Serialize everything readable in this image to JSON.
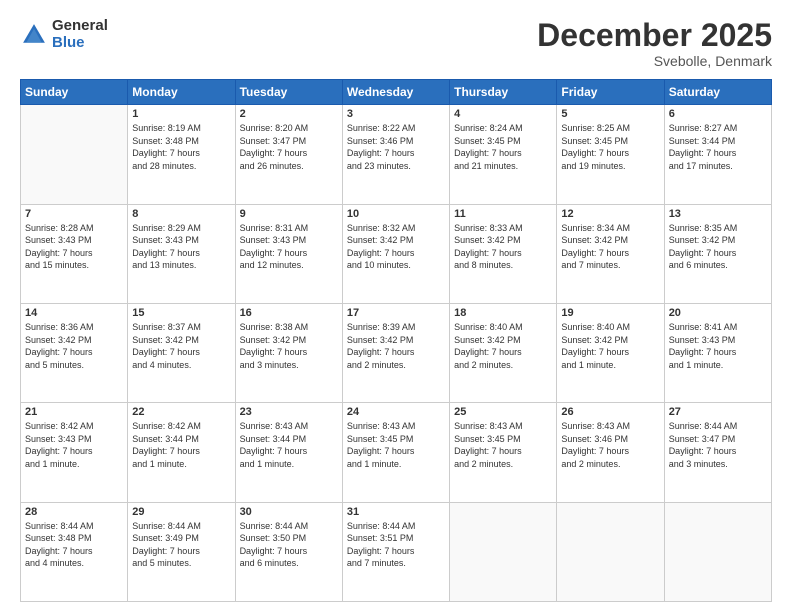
{
  "logo": {
    "general": "General",
    "blue": "Blue"
  },
  "header": {
    "month": "December 2025",
    "location": "Svebolle, Denmark"
  },
  "weekdays": [
    "Sunday",
    "Monday",
    "Tuesday",
    "Wednesday",
    "Thursday",
    "Friday",
    "Saturday"
  ],
  "weeks": [
    [
      {
        "day": "",
        "info": ""
      },
      {
        "day": "1",
        "info": "Sunrise: 8:19 AM\nSunset: 3:48 PM\nDaylight: 7 hours\nand 28 minutes."
      },
      {
        "day": "2",
        "info": "Sunrise: 8:20 AM\nSunset: 3:47 PM\nDaylight: 7 hours\nand 26 minutes."
      },
      {
        "day": "3",
        "info": "Sunrise: 8:22 AM\nSunset: 3:46 PM\nDaylight: 7 hours\nand 23 minutes."
      },
      {
        "day": "4",
        "info": "Sunrise: 8:24 AM\nSunset: 3:45 PM\nDaylight: 7 hours\nand 21 minutes."
      },
      {
        "day": "5",
        "info": "Sunrise: 8:25 AM\nSunset: 3:45 PM\nDaylight: 7 hours\nand 19 minutes."
      },
      {
        "day": "6",
        "info": "Sunrise: 8:27 AM\nSunset: 3:44 PM\nDaylight: 7 hours\nand 17 minutes."
      }
    ],
    [
      {
        "day": "7",
        "info": "Sunrise: 8:28 AM\nSunset: 3:43 PM\nDaylight: 7 hours\nand 15 minutes."
      },
      {
        "day": "8",
        "info": "Sunrise: 8:29 AM\nSunset: 3:43 PM\nDaylight: 7 hours\nand 13 minutes."
      },
      {
        "day": "9",
        "info": "Sunrise: 8:31 AM\nSunset: 3:43 PM\nDaylight: 7 hours\nand 12 minutes."
      },
      {
        "day": "10",
        "info": "Sunrise: 8:32 AM\nSunset: 3:42 PM\nDaylight: 7 hours\nand 10 minutes."
      },
      {
        "day": "11",
        "info": "Sunrise: 8:33 AM\nSunset: 3:42 PM\nDaylight: 7 hours\nand 8 minutes."
      },
      {
        "day": "12",
        "info": "Sunrise: 8:34 AM\nSunset: 3:42 PM\nDaylight: 7 hours\nand 7 minutes."
      },
      {
        "day": "13",
        "info": "Sunrise: 8:35 AM\nSunset: 3:42 PM\nDaylight: 7 hours\nand 6 minutes."
      }
    ],
    [
      {
        "day": "14",
        "info": "Sunrise: 8:36 AM\nSunset: 3:42 PM\nDaylight: 7 hours\nand 5 minutes."
      },
      {
        "day": "15",
        "info": "Sunrise: 8:37 AM\nSunset: 3:42 PM\nDaylight: 7 hours\nand 4 minutes."
      },
      {
        "day": "16",
        "info": "Sunrise: 8:38 AM\nSunset: 3:42 PM\nDaylight: 7 hours\nand 3 minutes."
      },
      {
        "day": "17",
        "info": "Sunrise: 8:39 AM\nSunset: 3:42 PM\nDaylight: 7 hours\nand 2 minutes."
      },
      {
        "day": "18",
        "info": "Sunrise: 8:40 AM\nSunset: 3:42 PM\nDaylight: 7 hours\nand 2 minutes."
      },
      {
        "day": "19",
        "info": "Sunrise: 8:40 AM\nSunset: 3:42 PM\nDaylight: 7 hours\nand 1 minute."
      },
      {
        "day": "20",
        "info": "Sunrise: 8:41 AM\nSunset: 3:43 PM\nDaylight: 7 hours\nand 1 minute."
      }
    ],
    [
      {
        "day": "21",
        "info": "Sunrise: 8:42 AM\nSunset: 3:43 PM\nDaylight: 7 hours\nand 1 minute."
      },
      {
        "day": "22",
        "info": "Sunrise: 8:42 AM\nSunset: 3:44 PM\nDaylight: 7 hours\nand 1 minute."
      },
      {
        "day": "23",
        "info": "Sunrise: 8:43 AM\nSunset: 3:44 PM\nDaylight: 7 hours\nand 1 minute."
      },
      {
        "day": "24",
        "info": "Sunrise: 8:43 AM\nSunset: 3:45 PM\nDaylight: 7 hours\nand 1 minute."
      },
      {
        "day": "25",
        "info": "Sunrise: 8:43 AM\nSunset: 3:45 PM\nDaylight: 7 hours\nand 2 minutes."
      },
      {
        "day": "26",
        "info": "Sunrise: 8:43 AM\nSunset: 3:46 PM\nDaylight: 7 hours\nand 2 minutes."
      },
      {
        "day": "27",
        "info": "Sunrise: 8:44 AM\nSunset: 3:47 PM\nDaylight: 7 hours\nand 3 minutes."
      }
    ],
    [
      {
        "day": "28",
        "info": "Sunrise: 8:44 AM\nSunset: 3:48 PM\nDaylight: 7 hours\nand 4 minutes."
      },
      {
        "day": "29",
        "info": "Sunrise: 8:44 AM\nSunset: 3:49 PM\nDaylight: 7 hours\nand 5 minutes."
      },
      {
        "day": "30",
        "info": "Sunrise: 8:44 AM\nSunset: 3:50 PM\nDaylight: 7 hours\nand 6 minutes."
      },
      {
        "day": "31",
        "info": "Sunrise: 8:44 AM\nSunset: 3:51 PM\nDaylight: 7 hours\nand 7 minutes."
      },
      {
        "day": "",
        "info": ""
      },
      {
        "day": "",
        "info": ""
      },
      {
        "day": "",
        "info": ""
      }
    ]
  ]
}
